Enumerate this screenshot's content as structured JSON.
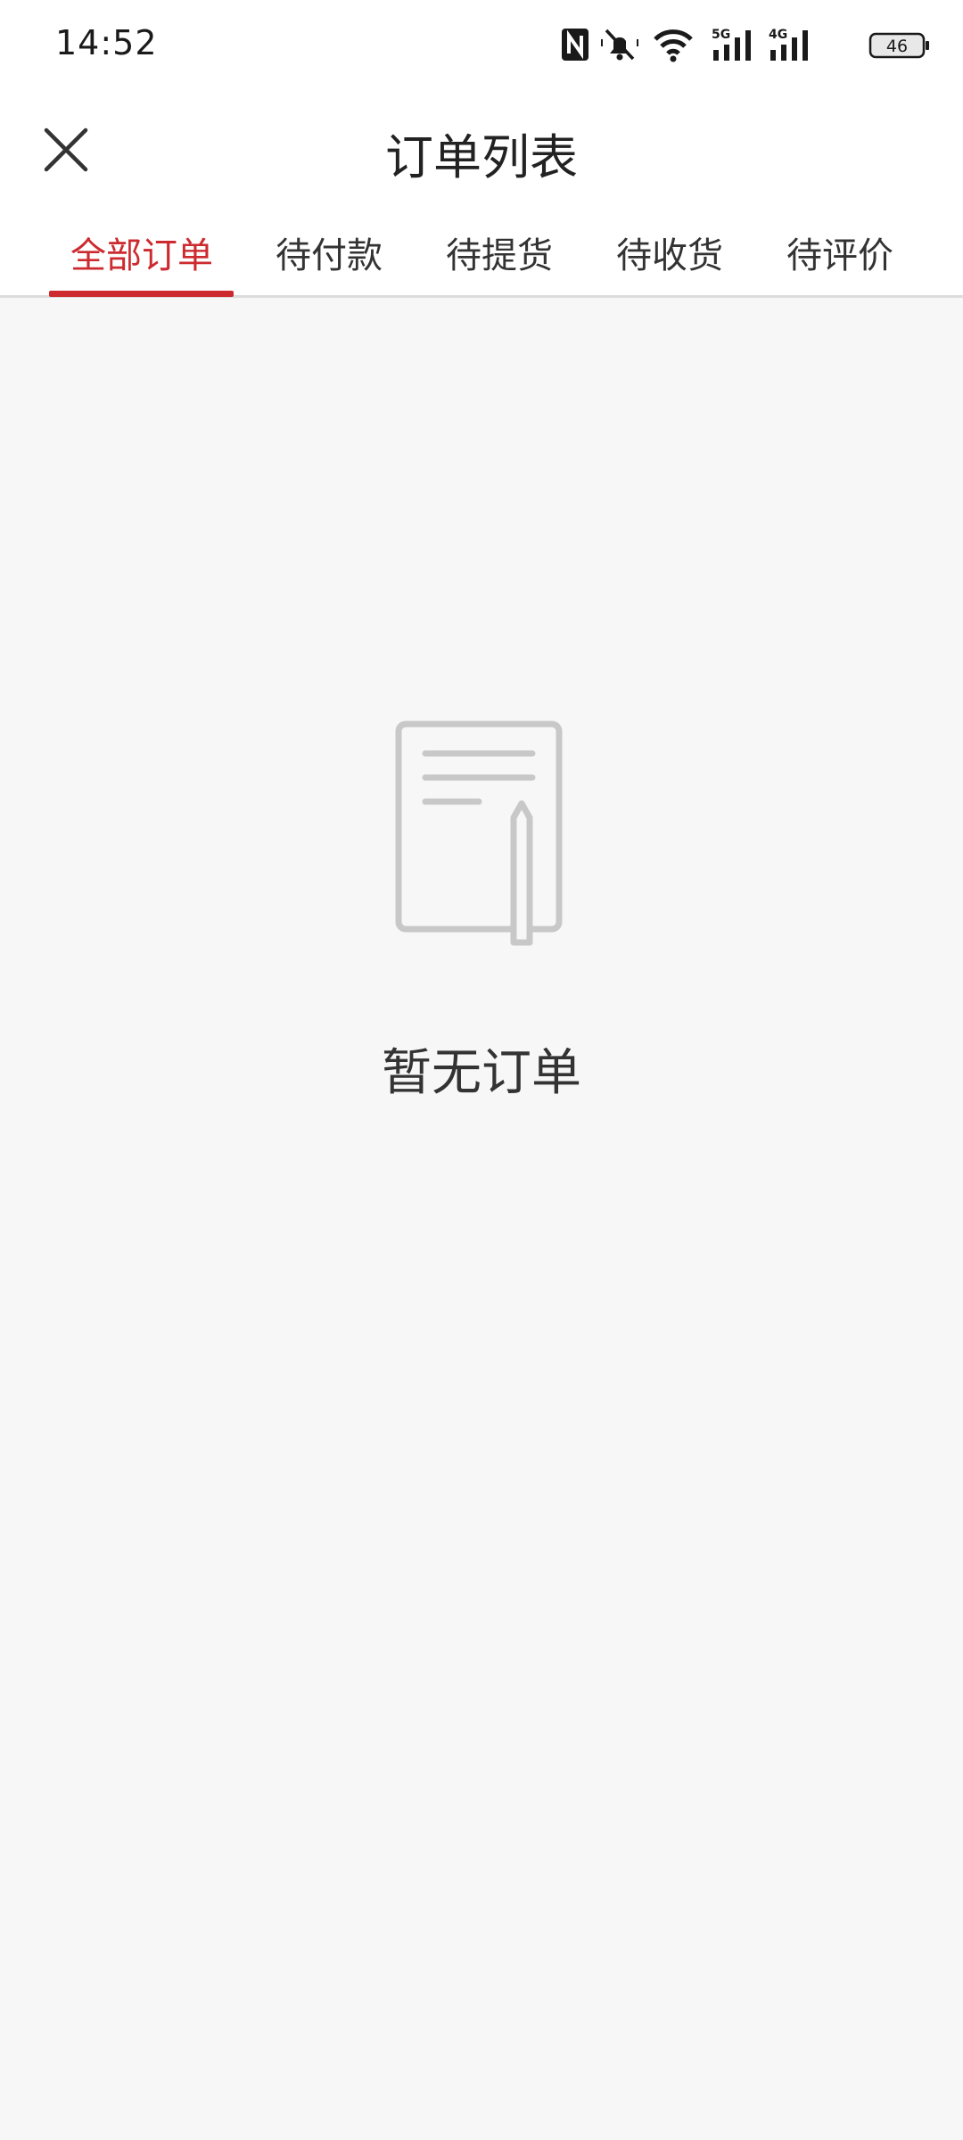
{
  "status_bar": {
    "time": "14:52",
    "battery": "46",
    "net_5g": "5G",
    "net_4g": "4G",
    "icons": [
      "nfc-icon",
      "bell-muted-icon",
      "wifi-icon",
      "signal-5g-icon",
      "signal-4g-icon",
      "battery-icon"
    ]
  },
  "header": {
    "title": "订单列表",
    "close_icon": "close-icon"
  },
  "tabs": [
    {
      "label": "全部订单",
      "active": true
    },
    {
      "label": "待付款",
      "active": false
    },
    {
      "label": "待提货",
      "active": false
    },
    {
      "label": "待收货",
      "active": false
    },
    {
      "label": "待评价",
      "active": false
    }
  ],
  "empty_state": {
    "icon": "notebook-pen-icon",
    "text": "暂无订单"
  },
  "colors": {
    "accent": "#cc2a2f",
    "background": "#f7f7f7",
    "icon_gray": "#c8c8c8"
  }
}
